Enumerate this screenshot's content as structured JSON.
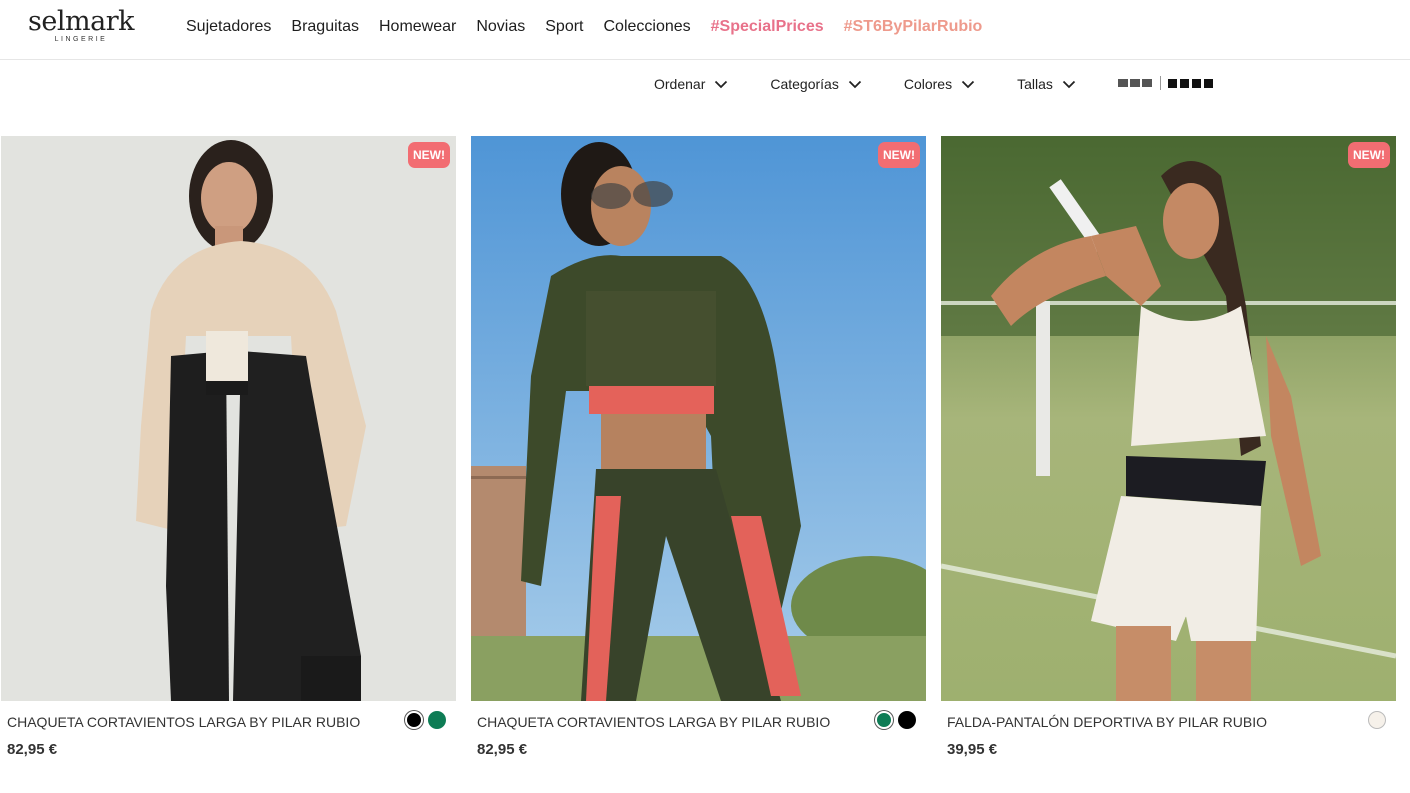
{
  "header": {
    "logo": {
      "main": "selmark",
      "sub": "LINGERIE"
    },
    "nav": [
      {
        "label": "Sujetadores"
      },
      {
        "label": "Braguitas"
      },
      {
        "label": "Homewear"
      },
      {
        "label": "Novias"
      },
      {
        "label": "Sport"
      },
      {
        "label": "Colecciones"
      },
      {
        "label": "#SpecialPrices"
      },
      {
        "label": "#ST6ByPilarRubio"
      }
    ]
  },
  "filters": [
    {
      "label": "Ordenar",
      "icon": "chevron-down-icon"
    },
    {
      "label": "Categorías",
      "icon": "chevron-down-icon"
    },
    {
      "label": "Colores",
      "icon": "chevron-down-icon"
    },
    {
      "label": "Tallas",
      "icon": "chevron-down-icon"
    }
  ],
  "view_modes": [
    "grid-3-icon",
    "grid-4-icon"
  ],
  "products": [
    {
      "badge": "NEW!",
      "name": "CHAQUETA CORTAVIENTOS LARGA BY PILAR RUBIO",
      "price": "82,95 €",
      "swatches": [
        "#000000",
        "#0e7c55"
      ],
      "image": "model-in-black-beige-windbreaker"
    },
    {
      "badge": "NEW!",
      "name": "CHAQUETA CORTAVIENTOS LARGA BY PILAR RUBIO",
      "price": "82,95 €",
      "swatches": [
        "#0e7c55",
        "#000000"
      ],
      "image": "model-in-green-windbreaker"
    },
    {
      "badge": "NEW!",
      "name": "FALDA-PANTALÓN DEPORTIVA BY PILAR RUBIO",
      "price": "39,95 €",
      "swatches": [
        "#f6f1ea"
      ],
      "image": "model-in-white-tennis-skort"
    }
  ],
  "colors": {
    "accent_pink": "#e8728a",
    "accent_salmon": "#ee9a8c",
    "badge": "#f26d72"
  }
}
